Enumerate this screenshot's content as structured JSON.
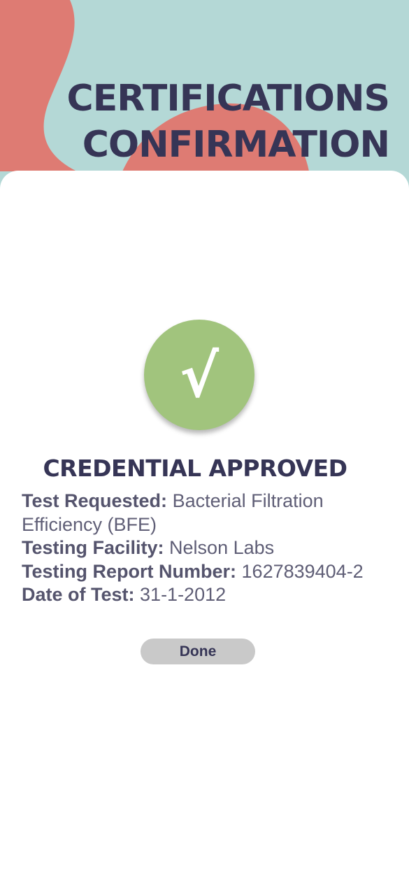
{
  "header": {
    "title_line1": "CERTIFICATIONS",
    "title_line2": "CONFIRMATION"
  },
  "colors": {
    "background_teal": "#b4d8d6",
    "blob_coral": "#de7b73",
    "title_navy": "#363556",
    "check_green": "#a1c47d",
    "button_gray": "#c9c9c9"
  },
  "status": {
    "icon": "check-icon",
    "check_glyph": "√",
    "heading": "CREDENTIAL APPROVED"
  },
  "details": {
    "test_requested_label": "Test Requested:",
    "test_requested_value": "Bacterial Filtration Efficiency (BFE)",
    "testing_facility_label": "Testing Facility:",
    "testing_facility_value": "Nelson Labs",
    "report_number_label": "Testing Report Number:",
    "report_number_value": "1627839404-2",
    "date_label": "Date of Test:",
    "date_value": "31-1-2012"
  },
  "actions": {
    "done_label": "Done"
  }
}
